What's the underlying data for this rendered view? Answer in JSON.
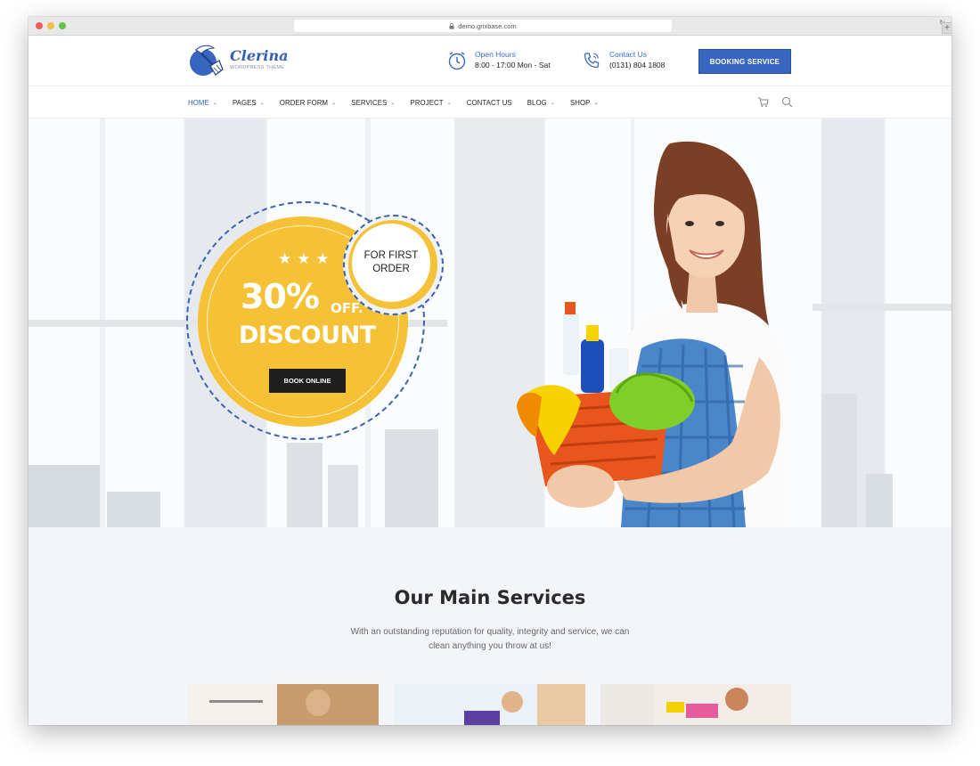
{
  "browser": {
    "url": "demo.grixbase.com",
    "colors": {
      "close": "#ee5f57",
      "minimize": "#f4be3f",
      "maximize": "#5fc448"
    }
  },
  "brand": {
    "name": "Clerina",
    "tagline": "WORDPRESS THEME",
    "accent": "#3866be",
    "yellow": "#f5c136"
  },
  "header": {
    "open_hours": {
      "label": "Open Hours",
      "value": "8:00 - 17:00 Mon - Sat",
      "icon": "clock-icon"
    },
    "contact": {
      "label": "Contact Us",
      "value": "(0131) 804 1808",
      "icon": "phone-icon"
    },
    "booking_label": "BOOKING SERVICE"
  },
  "nav": {
    "items": [
      {
        "label": "HOME",
        "active": true,
        "dropdown": true
      },
      {
        "label": "PAGES",
        "active": false,
        "dropdown": true
      },
      {
        "label": "ORDER FORM",
        "active": false,
        "dropdown": true
      },
      {
        "label": "SERVICES",
        "active": false,
        "dropdown": true
      },
      {
        "label": "PROJECT",
        "active": false,
        "dropdown": true
      },
      {
        "label": "CONTACT US",
        "active": false,
        "dropdown": false
      },
      {
        "label": "BLOG",
        "active": false,
        "dropdown": true
      },
      {
        "label": "SHOP",
        "active": false,
        "dropdown": true
      }
    ],
    "icons": [
      "cart-icon",
      "search-icon"
    ]
  },
  "hero": {
    "stars": "★★★",
    "percent": "30%",
    "off": "OFF.",
    "discount": "DISCOUNT",
    "cta": "BOOK ONLINE",
    "first_order_line1": "FOR FIRST",
    "first_order_line2": "ORDER"
  },
  "services": {
    "title": "Our Main Services",
    "description_line1": "With an outstanding reputation for quality, integrity and service, we can",
    "description_line2": "clean anything you throw at us!"
  }
}
